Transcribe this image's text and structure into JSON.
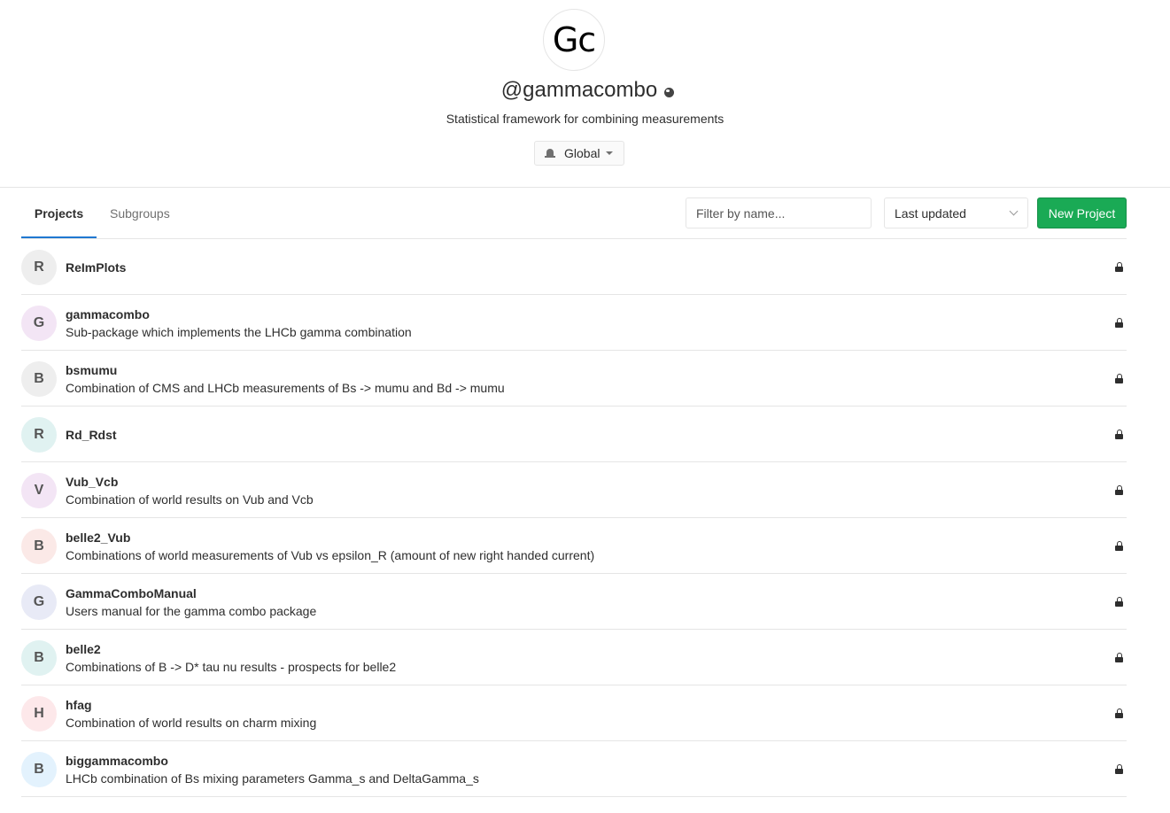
{
  "group": {
    "avatar_text": "Gc",
    "title": "@gammacombo",
    "visibility_icon": "globe-icon",
    "description": "Statistical framework for combining measurements",
    "notification_label": "Global"
  },
  "tabs": [
    {
      "label": "Projects",
      "active": true
    },
    {
      "label": "Subgroups",
      "active": false
    }
  ],
  "filter": {
    "placeholder": "Filter by name..."
  },
  "sort": {
    "selected": "Last updated"
  },
  "new_project_label": "New Project",
  "projects": [
    {
      "letter": "R",
      "name": "ReImPlots",
      "description": "",
      "avatar_color": "#eeeeee",
      "private": true
    },
    {
      "letter": "G",
      "name": "gammacombo",
      "description": "Sub-package which implements the LHCb gamma combination",
      "avatar_color": "#f3e5f5",
      "private": true
    },
    {
      "letter": "B",
      "name": "bsmumu",
      "description": "Combination of CMS and LHCb measurements of Bs -> mumu and Bd -> mumu",
      "avatar_color": "#eeeeee",
      "private": true
    },
    {
      "letter": "R",
      "name": "Rd_Rdst",
      "description": "",
      "avatar_color": "#e0f2f1",
      "private": true
    },
    {
      "letter": "V",
      "name": "Vub_Vcb",
      "description": "Combination of world results on Vub and Vcb",
      "avatar_color": "#f3e5f5",
      "private": true
    },
    {
      "letter": "B",
      "name": "belle2_Vub",
      "description": "Combinations of world measurements of Vub vs epsilon_R (amount of new right handed current)",
      "avatar_color": "#fbe9e7",
      "private": true
    },
    {
      "letter": "G",
      "name": "GammaComboManual",
      "description": "Users manual for the gamma combo package",
      "avatar_color": "#e8eaf6",
      "private": true
    },
    {
      "letter": "B",
      "name": "belle2",
      "description": "Combinations of B -> D* tau nu results - prospects for belle2",
      "avatar_color": "#e0f2f1",
      "private": true
    },
    {
      "letter": "H",
      "name": "hfag",
      "description": "Combination of world results on charm mixing",
      "avatar_color": "#fde8ea",
      "private": true
    },
    {
      "letter": "B",
      "name": "biggammacombo",
      "description": "LHCb combination of Bs mixing parameters Gamma_s and DeltaGamma_s",
      "avatar_color": "#e3f2fd",
      "private": true
    }
  ]
}
